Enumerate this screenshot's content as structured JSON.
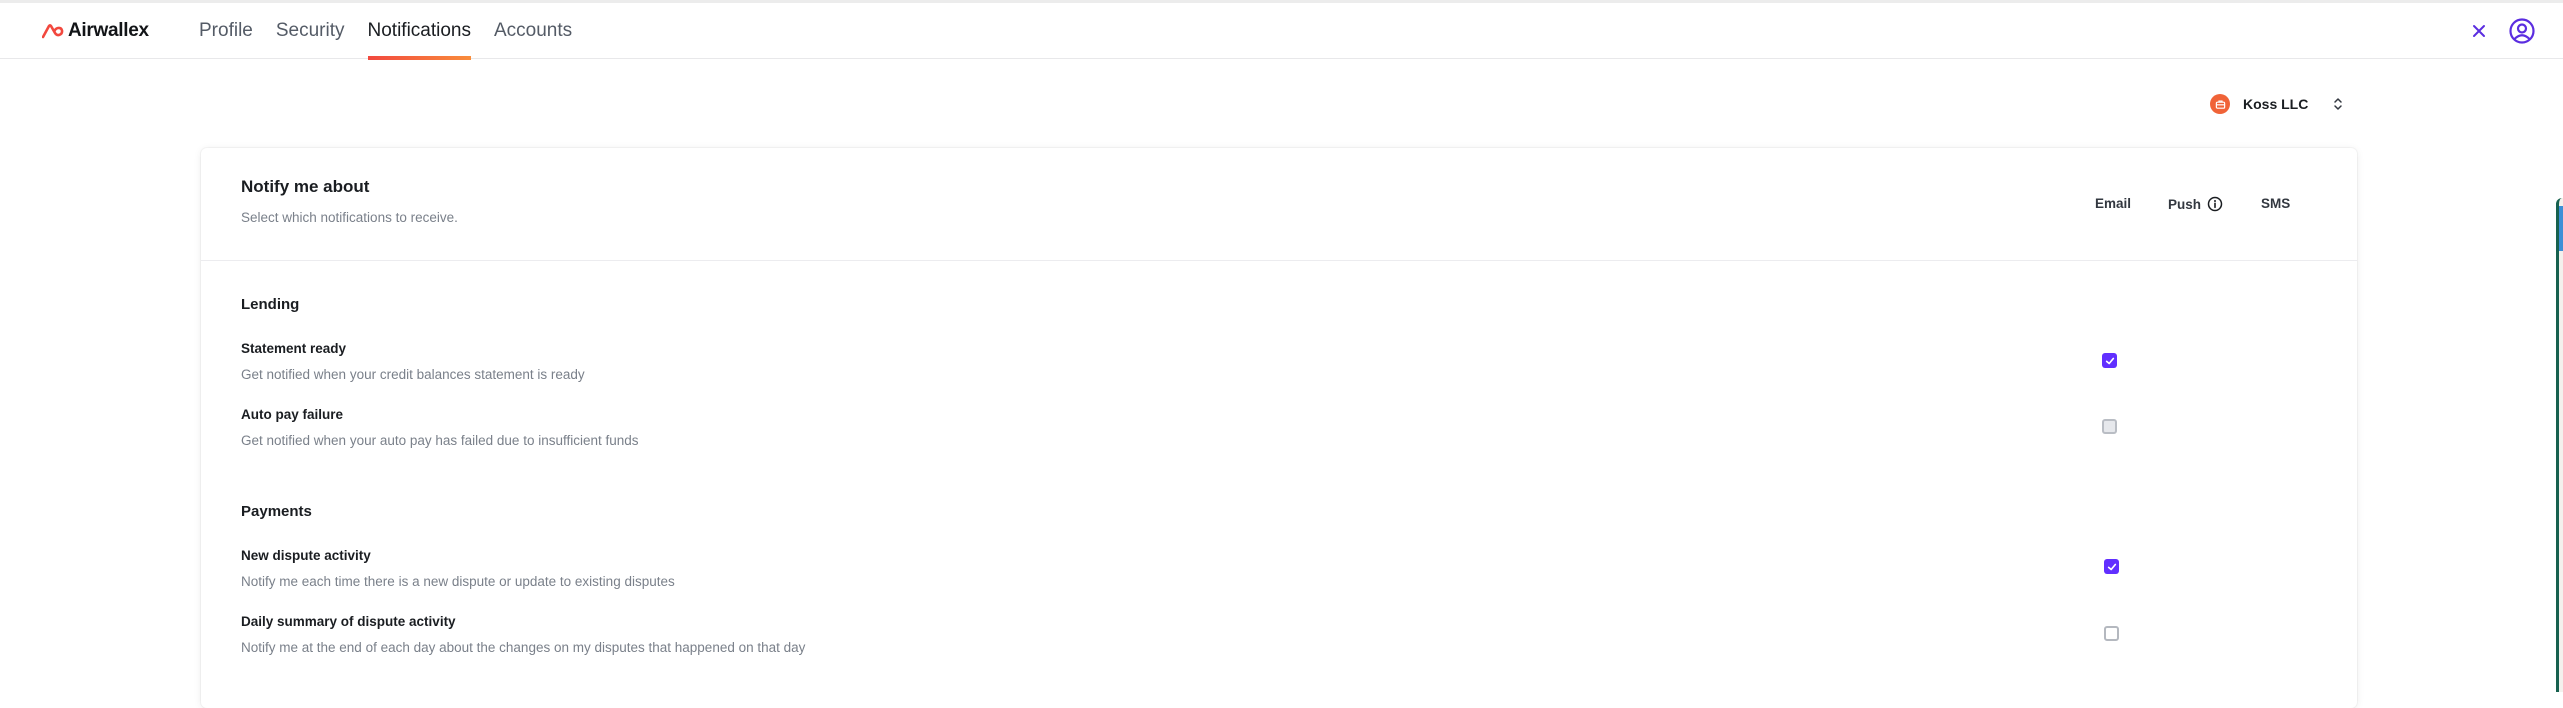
{
  "header": {
    "brand": "Airwallex",
    "brand_color": "#f2483e",
    "nav": [
      {
        "label": "Profile",
        "active": false
      },
      {
        "label": "Security",
        "active": false
      },
      {
        "label": "Notifications",
        "active": true
      },
      {
        "label": "Accounts",
        "active": false
      }
    ],
    "close_icon": "close-icon",
    "user_icon": "user-circle-icon",
    "accent_color": "#612fff"
  },
  "account_selector": {
    "name": "Koss LLC",
    "icon": "briefcase-icon",
    "icon_color": "#f06338"
  },
  "card": {
    "title": "Notify me about",
    "subtitle": "Select which notifications to receive.",
    "columns": [
      {
        "label": "Email",
        "has_info": false
      },
      {
        "label": "Push",
        "has_info": true
      },
      {
        "label": "SMS",
        "has_info": false
      }
    ],
    "sections": [
      {
        "title": "Lending",
        "items": [
          {
            "title": "Statement ready",
            "description": "Get notified when your credit balances statement is ready",
            "email": "checked"
          },
          {
            "title": "Auto pay failure",
            "description": "Get notified when your auto pay has failed due to insufficient funds",
            "email": "disabled"
          }
        ]
      },
      {
        "title": "Payments",
        "items": [
          {
            "title": "New dispute activity",
            "description": "Notify me each time there is a new dispute or update to existing disputes",
            "email": "checked"
          },
          {
            "title": "Daily summary of dispute activity",
            "description": "Notify me at the end of each day about the changes on my disputes that happened on that day",
            "email": "unchecked"
          }
        ]
      }
    ]
  }
}
